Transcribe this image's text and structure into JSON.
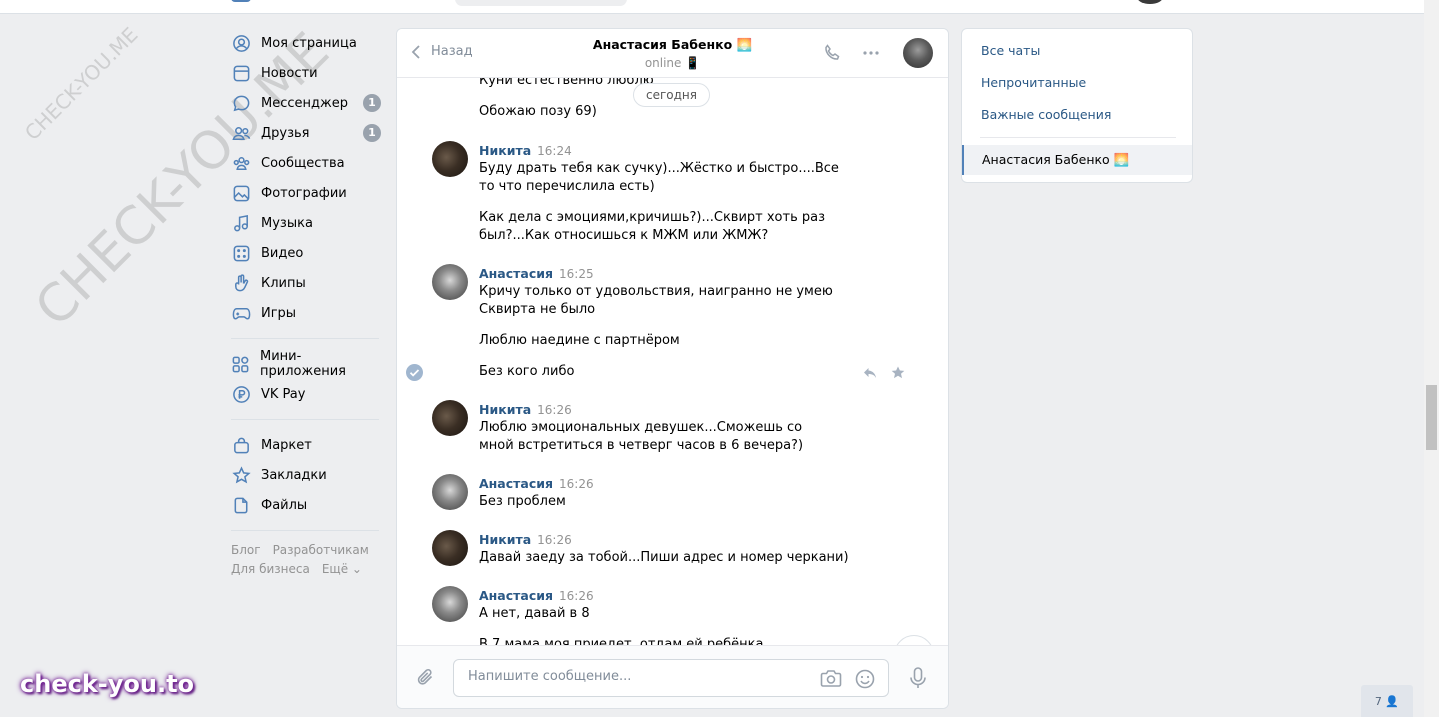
{
  "watermark": {
    "big": "CHECK-YOU.ME",
    "small": "CHECK-YOU.ME",
    "badge": "check-you.to"
  },
  "nav": {
    "items": [
      {
        "label": "Моя страница"
      },
      {
        "label": "Новости"
      },
      {
        "label": "Мессенджер",
        "count": "1"
      },
      {
        "label": "Друзья",
        "count": "1"
      },
      {
        "label": "Сообщества"
      },
      {
        "label": "Фотографии"
      },
      {
        "label": "Музыка"
      },
      {
        "label": "Видео"
      },
      {
        "label": "Клипы"
      },
      {
        "label": "Игры"
      },
      {
        "label": "Мини-приложения"
      },
      {
        "label": "VK Pay"
      },
      {
        "label": "Маркет"
      },
      {
        "label": "Закладки"
      },
      {
        "label": "Файлы"
      }
    ],
    "footer": {
      "blog": "Блог",
      "dev": "Разработчикам",
      "business": "Для бизнеса",
      "more": "Ещё ⌄"
    }
  },
  "chat": {
    "back_label": "Назад",
    "peer_name": "Анастасия Бабенко 🌅",
    "peer_status": "online 📱",
    "date_pill": "сегодня",
    "messages": {
      "m0_text1": "Куни естественно люблю",
      "m0_text2": "Обожаю позу 69)",
      "m1_author": "Никита",
      "m1_time": "16:24",
      "m1_text1": "Буду драть тебя как сучку)...Жёстко и быстро....Все то что перечислила есть)",
      "m1_text2": "Как дела с эмоциями,кричишь?)...Сквирт хоть раз был?...Как относишься к МЖМ или ЖМЖ?",
      "m2_author": "Анастасия",
      "m2_time": "16:25",
      "m2_text1": "Кричу только от удовольствия, наигранно не умею",
      "m2_text1b": "Сквирта не было",
      "m2_text2": "Люблю наедине с партнёром",
      "m2_text3": "Без кого либо",
      "m3_author": "Никита",
      "m3_time": "16:26",
      "m3_text1": "Люблю эмоциональных девушек...Сможешь со мной встретиться в четверг часов в 6 вечера?)",
      "m4_author": "Анастасия",
      "m4_time": "16:26",
      "m4_text1": "Без проблем",
      "m5_author": "Никита",
      "m5_time": "16:26",
      "m5_text1": "Давай заеду за тобой...Пиши адрес и номер черкани)",
      "m6_author": "Анастасия",
      "m6_time": "16:26",
      "m6_text1": "А нет, давай в 8",
      "m6_text2": "В 7 мама моя приедет, отдам ей ребёнка"
    },
    "composer_placeholder": "Напишите сообщение..."
  },
  "right_panel": {
    "all_chats": "Все чаты",
    "unread": "Непрочитанные",
    "important": "Важные сообщения",
    "selected_chat": "Анастасия Бабенко 🌅"
  },
  "online_widget": "7 👤",
  "colors": {
    "accent": "#5181b8",
    "link": "#2a5885",
    "background": "#edeef0",
    "badge": "#99a2ad"
  }
}
